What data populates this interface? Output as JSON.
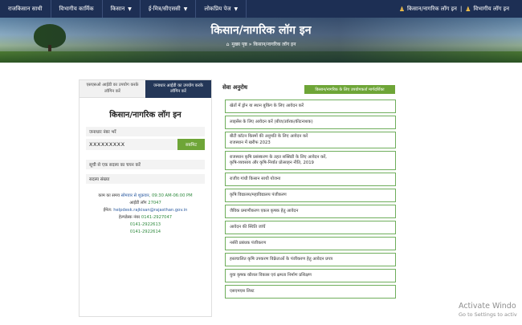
{
  "nav": {
    "items": [
      {
        "label": "राजकिसान साथी",
        "dropdown": false
      },
      {
        "label": "विभागीय कार्मिक",
        "dropdown": false
      },
      {
        "label": "किसान",
        "dropdown": true
      },
      {
        "label": "ई-मित्र/सीएससी",
        "dropdown": true
      },
      {
        "label": "लोकप्रिय पेज",
        "dropdown": true
      }
    ],
    "farmer_login": "किसान/नागरिक लॉग इन",
    "separator": "|",
    "dept_login": "विभागीय लॉग इन"
  },
  "hero": {
    "title": "किसान/नागरिक लॉग इन",
    "breadcrumb_home": "मुख्य पृष्ठ",
    "breadcrumb_sep": "»",
    "breadcrumb_current": "किसान/नागरिक लॉग इन"
  },
  "login": {
    "tab_ssoid": "एसएसओ आईडी का उपयोग करके लॉगिन करें",
    "tab_janaadhaar": "जनाधार आईडी का उपयोग करके लॉगिन करें",
    "title": "किसान/नागरिक लॉग इन",
    "mobile_label": "जनाधार नंबर भरें",
    "mobile_value": "XXXXXXXXX",
    "submit_label": "सबमिट",
    "member_select": "सूची से एक सदस्य का चयन करें",
    "member_number": "सदस्य संख्या"
  },
  "contact": {
    "hours_prefix": "काम का समय",
    "hours_days": "सोमवार से शुक्रवार",
    "hours_time": ", 09:30 AM-06:00 PM",
    "id_label": "आईडी लॉग",
    "id_value": "27047",
    "email_label": "ईमेल:",
    "email_value": "helpdesk.rajkisan@rajasthan.gov.in",
    "helpline_label": "हेल्पडेस्क नंबर",
    "phone1": "0141-2927047",
    "phone2": "0141-2922613",
    "phone3": "0141-2922614"
  },
  "services": {
    "title": "सेवा अनुरोध",
    "guide_button": "किसान/नागरिक के लिए उपयोगकर्ता मार्गदर्शिका",
    "items": [
      {
        "text": "खेतों में ड्रोन या स्थान बुकिंग के लिए आवेदन करें"
      },
      {
        "text": "लाइसेंस के लिए आवेदन करें (बीज/उर्वरक/कीटनाशक)"
      },
      {
        "text": "बीटी कॉटन किस्मों की अनुमति के लिए आवेदन करें",
        "sub": "राजस्थान में खरीफ 2023"
      },
      {
        "text": "राजस्थान कृषि प्रसंस्करण के तहत सब्सिडी के लिए आवेदन करें,",
        "sub": "कृषि-व्यवसाय और कृषि-निर्यात प्रोत्साहन नीति, 2019"
      },
      {
        "text": "राजीव गांधी किसान साथी योजना"
      },
      {
        "text": "कृषि विद्यालय/महाविद्यालय पंजीकरण"
      },
      {
        "text": "जैविक प्रमाणीकरण एकल कृषक हेतु आवेदन"
      },
      {
        "text": "आवेदन की स्थिति जांचें"
      },
      {
        "text": "नर्सरी प्रबंधक पंजीकरण"
      },
      {
        "text": "हस्तचालित कृषि उपकरण विक्रेताओं के पंजीकरण हेतु आवेदन प्रपत्र"
      },
      {
        "text": "युवा कृषक कौशल विकास एवं क्षमता निर्माण प्रशिक्षण"
      },
      {
        "text": "एसएमएस लिस्ट"
      }
    ]
  },
  "watermark": {
    "line1": "Activate Windo",
    "line2": "Go to Settings to activ"
  }
}
